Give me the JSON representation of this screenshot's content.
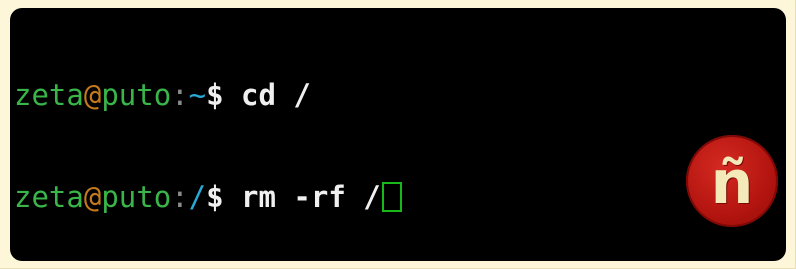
{
  "terminal": {
    "lines": [
      {
        "user": "zeta",
        "at": "@",
        "host": "puto",
        "colon": ":",
        "path": "~",
        "prompt": "$",
        "command": " cd /"
      },
      {
        "user": "zeta",
        "at": "@",
        "host": "puto",
        "colon": ":",
        "path": "/",
        "prompt": "$",
        "command": " rm -rf /"
      }
    ]
  },
  "logo": {
    "glyph": "ñ"
  },
  "colors": {
    "background": "#000000",
    "user": "#39b54a",
    "at": "#c47a1c",
    "path": "#2aa8d6",
    "cursor": "#18b818",
    "logo": "#b3140f"
  },
  "icons": {
    "logo": "n-tilde-logo-icon",
    "cursor": "block-cursor"
  }
}
